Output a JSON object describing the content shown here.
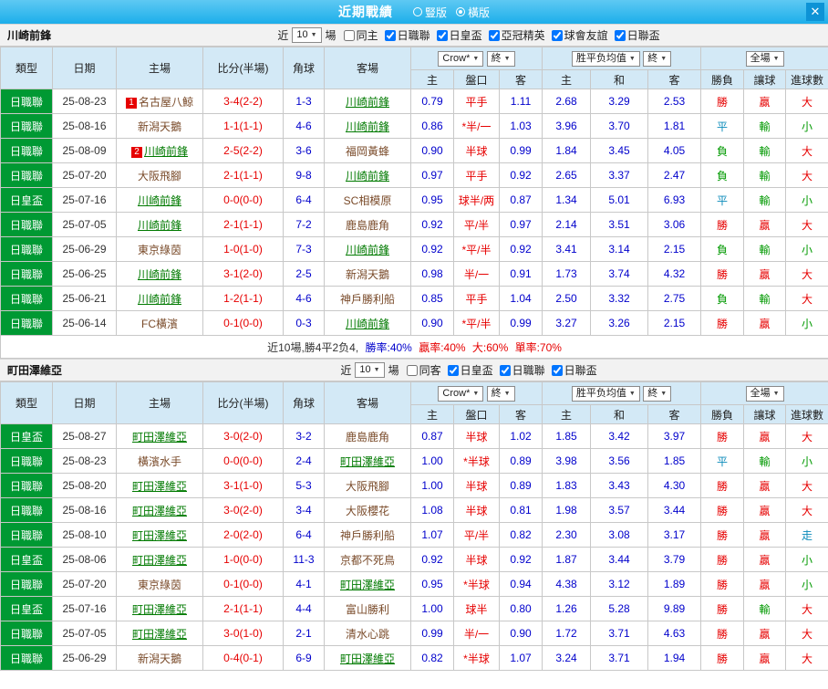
{
  "titlebar": {
    "title": "近期戰績",
    "radio_vertical": "豎版",
    "radio_horizontal": "橫版",
    "close": "✕"
  },
  "colors": {
    "titlebar_top": "#5ec9f3",
    "titlebar_bottom": "#1caeea",
    "header_bg": "#d3e9f6",
    "type_bg": "#009933",
    "focal_team": "#007a00",
    "other_team": "#7a4b2a",
    "odds": "#0000cc",
    "corner": "#0000cc",
    "score": "#e60000",
    "handicap": "#e60000"
  },
  "result_colors": {
    "勝": "#e60000",
    "平": "#0b8bbb",
    "負": "#009900",
    "贏": "#e60000",
    "輸": "#009900",
    "大": "#e60000",
    "小": "#009900",
    "走": "#0b8bbb"
  },
  "sections": [
    {
      "team": "川崎前鋒",
      "filter": {
        "near": "近",
        "count": "10",
        "games": "場",
        "checkboxes": [
          {
            "label": "同主",
            "checked": false
          },
          {
            "label": "日職聯",
            "checked": true
          },
          {
            "label": "日皇盃",
            "checked": true
          },
          {
            "label": "亞冠精英",
            "checked": true
          },
          {
            "label": "球會友誼",
            "checked": true
          },
          {
            "label": "日聯盃",
            "checked": true
          }
        ]
      },
      "header": {
        "type": "類型",
        "date": "日期",
        "home": "主場",
        "score": "比分(半場)",
        "corner": "角球",
        "away": "客場",
        "odds_source": "Crow*",
        "odds_final": "終",
        "europe": "胜平负均值",
        "europe_final": "終",
        "full": "全場",
        "sub": [
          "主",
          "盤口",
          "客",
          "主",
          "和",
          "客",
          "勝負",
          "讓球",
          "進球數"
        ]
      },
      "rows": [
        {
          "type": "日職聯",
          "date": "25-08-23",
          "home": {
            "name": "名古屋八鯨",
            "badge": "1",
            "focal": false
          },
          "score": "3-4(2-2)",
          "corner": "1-3",
          "away": {
            "name": "川崎前鋒",
            "focal": true
          },
          "odds": [
            "0.79",
            "平手",
            "1.11"
          ],
          "europe": [
            "2.68",
            "3.29",
            "2.53"
          ],
          "results": [
            "勝",
            "贏",
            "大"
          ]
        },
        {
          "type": "日職聯",
          "date": "25-08-16",
          "home": {
            "name": "新潟天鵝",
            "focal": false
          },
          "score": "1-1(1-1)",
          "corner": "4-6",
          "away": {
            "name": "川崎前鋒",
            "focal": true
          },
          "odds": [
            "0.86",
            "*半/一",
            "1.03"
          ],
          "europe": [
            "3.96",
            "3.70",
            "1.81"
          ],
          "results": [
            "平",
            "輸",
            "小"
          ]
        },
        {
          "type": "日職聯",
          "date": "25-08-09",
          "home": {
            "name": "川崎前鋒",
            "badge": "2",
            "focal": true
          },
          "score": "2-5(2-2)",
          "corner": "3-6",
          "away": {
            "name": "福岡黃蜂",
            "focal": false
          },
          "odds": [
            "0.90",
            "半球",
            "0.99"
          ],
          "europe": [
            "1.84",
            "3.45",
            "4.05"
          ],
          "results": [
            "負",
            "輸",
            "大"
          ]
        },
        {
          "type": "日職聯",
          "date": "25-07-20",
          "home": {
            "name": "大阪飛腳",
            "focal": false
          },
          "score": "2-1(1-1)",
          "corner": "9-8",
          "away": {
            "name": "川崎前鋒",
            "focal": true
          },
          "odds": [
            "0.97",
            "平手",
            "0.92"
          ],
          "europe": [
            "2.65",
            "3.37",
            "2.47"
          ],
          "results": [
            "負",
            "輸",
            "大"
          ]
        },
        {
          "type": "日皇盃",
          "date": "25-07-16",
          "home": {
            "name": "川崎前鋒",
            "focal": true
          },
          "score": "0-0(0-0)",
          "corner": "6-4",
          "away": {
            "name": "SC相模原",
            "focal": false
          },
          "odds": [
            "0.95",
            "球半/两",
            "0.87"
          ],
          "europe": [
            "1.34",
            "5.01",
            "6.93"
          ],
          "results": [
            "平",
            "輸",
            "小"
          ]
        },
        {
          "type": "日職聯",
          "date": "25-07-05",
          "home": {
            "name": "川崎前鋒",
            "focal": true
          },
          "score": "2-1(1-1)",
          "corner": "7-2",
          "away": {
            "name": "鹿島鹿角",
            "focal": false
          },
          "odds": [
            "0.92",
            "平/半",
            "0.97"
          ],
          "europe": [
            "2.14",
            "3.51",
            "3.06"
          ],
          "results": [
            "勝",
            "贏",
            "大"
          ]
        },
        {
          "type": "日職聯",
          "date": "25-06-29",
          "home": {
            "name": "東京綠茵",
            "focal": false
          },
          "score": "1-0(1-0)",
          "corner": "7-3",
          "away": {
            "name": "川崎前鋒",
            "focal": true
          },
          "odds": [
            "0.92",
            "*平/半",
            "0.92"
          ],
          "europe": [
            "3.41",
            "3.14",
            "2.15"
          ],
          "results": [
            "負",
            "輸",
            "小"
          ]
        },
        {
          "type": "日職聯",
          "date": "25-06-25",
          "home": {
            "name": "川崎前鋒",
            "focal": true
          },
          "score": "3-1(2-0)",
          "corner": "2-5",
          "away": {
            "name": "新潟天鵝",
            "focal": false
          },
          "odds": [
            "0.98",
            "半/一",
            "0.91"
          ],
          "europe": [
            "1.73",
            "3.74",
            "4.32"
          ],
          "results": [
            "勝",
            "贏",
            "大"
          ]
        },
        {
          "type": "日職聯",
          "date": "25-06-21",
          "home": {
            "name": "川崎前鋒",
            "focal": true
          },
          "score": "1-2(1-1)",
          "corner": "4-6",
          "away": {
            "name": "神戶勝利船",
            "focal": false
          },
          "odds": [
            "0.85",
            "平手",
            "1.04"
          ],
          "europe": [
            "2.50",
            "3.32",
            "2.75"
          ],
          "results": [
            "負",
            "輸",
            "大"
          ]
        },
        {
          "type": "日職聯",
          "date": "25-06-14",
          "home": {
            "name": "FC橫濱",
            "focal": false
          },
          "score": "0-1(0-0)",
          "corner": "0-3",
          "away": {
            "name": "川崎前鋒",
            "focal": true
          },
          "odds": [
            "0.90",
            "*平/半",
            "0.99"
          ],
          "europe": [
            "3.27",
            "3.26",
            "2.15"
          ],
          "results": [
            "勝",
            "贏",
            "小"
          ]
        }
      ],
      "summary": [
        {
          "text": "近10場,勝4平2负4, ",
          "color": "#333333"
        },
        {
          "text": "勝率:40%",
          "color": "#0000cc"
        },
        {
          "text": " 贏率:40%",
          "color": "#e60000"
        },
        {
          "text": " 大:60%",
          "color": "#e60000"
        },
        {
          "text": " 單率:70%",
          "color": "#e60000"
        }
      ]
    },
    {
      "team": "町田澤維亞",
      "filter": {
        "near": "近",
        "count": "10",
        "games": "場",
        "checkboxes": [
          {
            "label": "同客",
            "checked": false
          },
          {
            "label": "日皇盃",
            "checked": true
          },
          {
            "label": "日職聯",
            "checked": true
          },
          {
            "label": "日聯盃",
            "checked": true
          }
        ]
      },
      "header": {
        "type": "類型",
        "date": "日期",
        "home": "主場",
        "score": "比分(半場)",
        "corner": "角球",
        "away": "客場",
        "odds_source": "Crow*",
        "odds_final": "終",
        "europe": "胜平负均值",
        "europe_final": "終",
        "full": "全場",
        "sub": [
          "主",
          "盤口",
          "客",
          "主",
          "和",
          "客",
          "勝負",
          "讓球",
          "進球數"
        ]
      },
      "rows": [
        {
          "type": "日皇盃",
          "date": "25-08-27",
          "home": {
            "name": "町田澤維亞",
            "focal": true
          },
          "score": "3-0(2-0)",
          "corner": "3-2",
          "away": {
            "name": "鹿島鹿角",
            "focal": false
          },
          "odds": [
            "0.87",
            "半球",
            "1.02"
          ],
          "europe": [
            "1.85",
            "3.42",
            "3.97"
          ],
          "results": [
            "勝",
            "贏",
            "大"
          ]
        },
        {
          "type": "日職聯",
          "date": "25-08-23",
          "home": {
            "name": "橫濱水手",
            "focal": false
          },
          "score": "0-0(0-0)",
          "corner": "2-4",
          "away": {
            "name": "町田澤維亞",
            "focal": true
          },
          "odds": [
            "1.00",
            "*半球",
            "0.89"
          ],
          "europe": [
            "3.98",
            "3.56",
            "1.85"
          ],
          "results": [
            "平",
            "輸",
            "小"
          ]
        },
        {
          "type": "日職聯",
          "date": "25-08-20",
          "home": {
            "name": "町田澤維亞",
            "focal": true
          },
          "score": "3-1(1-0)",
          "corner": "5-3",
          "away": {
            "name": "大阪飛腳",
            "focal": false
          },
          "odds": [
            "1.00",
            "半球",
            "0.89"
          ],
          "europe": [
            "1.83",
            "3.43",
            "4.30"
          ],
          "results": [
            "勝",
            "贏",
            "大"
          ]
        },
        {
          "type": "日職聯",
          "date": "25-08-16",
          "home": {
            "name": "町田澤維亞",
            "focal": true
          },
          "score": "3-0(2-0)",
          "corner": "3-4",
          "away": {
            "name": "大阪櫻花",
            "focal": false
          },
          "odds": [
            "1.08",
            "半球",
            "0.81"
          ],
          "europe": [
            "1.98",
            "3.57",
            "3.44"
          ],
          "results": [
            "勝",
            "贏",
            "大"
          ]
        },
        {
          "type": "日職聯",
          "date": "25-08-10",
          "home": {
            "name": "町田澤維亞",
            "focal": true
          },
          "score": "2-0(2-0)",
          "corner": "6-4",
          "away": {
            "name": "神戶勝利船",
            "focal": false
          },
          "odds": [
            "1.07",
            "平/半",
            "0.82"
          ],
          "europe": [
            "2.30",
            "3.08",
            "3.17"
          ],
          "results": [
            "勝",
            "贏",
            "走"
          ]
        },
        {
          "type": "日皇盃",
          "date": "25-08-06",
          "home": {
            "name": "町田澤維亞",
            "focal": true
          },
          "score": "1-0(0-0)",
          "corner": "11-3",
          "away": {
            "name": "京都不死鳥",
            "focal": false
          },
          "odds": [
            "0.92",
            "半球",
            "0.92"
          ],
          "europe": [
            "1.87",
            "3.44",
            "3.79"
          ],
          "results": [
            "勝",
            "贏",
            "小"
          ]
        },
        {
          "type": "日職聯",
          "date": "25-07-20",
          "home": {
            "name": "東京綠茵",
            "focal": false
          },
          "score": "0-1(0-0)",
          "corner": "4-1",
          "away": {
            "name": "町田澤維亞",
            "focal": true
          },
          "odds": [
            "0.95",
            "*半球",
            "0.94"
          ],
          "europe": [
            "4.38",
            "3.12",
            "1.89"
          ],
          "results": [
            "勝",
            "贏",
            "小"
          ]
        },
        {
          "type": "日皇盃",
          "date": "25-07-16",
          "home": {
            "name": "町田澤維亞",
            "focal": true
          },
          "score": "2-1(1-1)",
          "corner": "4-4",
          "away": {
            "name": "富山勝利",
            "focal": false
          },
          "odds": [
            "1.00",
            "球半",
            "0.80"
          ],
          "europe": [
            "1.26",
            "5.28",
            "9.89"
          ],
          "results": [
            "勝",
            "輸",
            "大"
          ]
        },
        {
          "type": "日職聯",
          "date": "25-07-05",
          "home": {
            "name": "町田澤維亞",
            "focal": true
          },
          "score": "3-0(1-0)",
          "corner": "2-1",
          "away": {
            "name": "清水心跳",
            "focal": false
          },
          "odds": [
            "0.99",
            "半/一",
            "0.90"
          ],
          "europe": [
            "1.72",
            "3.71",
            "4.63"
          ],
          "results": [
            "勝",
            "贏",
            "大"
          ]
        },
        {
          "type": "日職聯",
          "date": "25-06-29",
          "home": {
            "name": "新潟天鵝",
            "focal": false
          },
          "score": "0-4(0-1)",
          "corner": "6-9",
          "away": {
            "name": "町田澤維亞",
            "focal": true
          },
          "odds": [
            "0.82",
            "*半球",
            "1.07"
          ],
          "europe": [
            "3.24",
            "3.71",
            "1.94"
          ],
          "results": [
            "勝",
            "贏",
            "大"
          ]
        }
      ]
    }
  ]
}
